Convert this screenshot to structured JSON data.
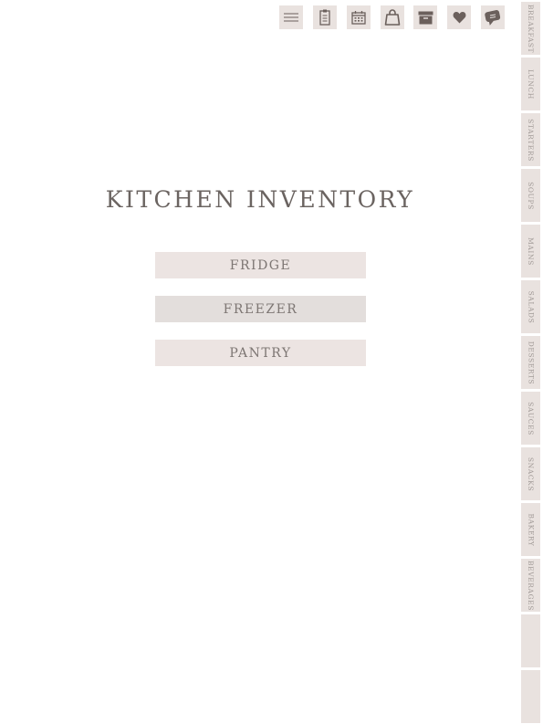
{
  "toolbar": {
    "items": [
      {
        "name": "menu",
        "icon": "menu-icon"
      },
      {
        "name": "notes",
        "icon": "notepad-icon"
      },
      {
        "name": "calendar",
        "icon": "calendar-icon"
      },
      {
        "name": "shopping",
        "icon": "shopping-bag-icon"
      },
      {
        "name": "archive",
        "icon": "archive-box-icon"
      },
      {
        "name": "favorites",
        "icon": "heart-icon"
      },
      {
        "name": "chat",
        "icon": "speech-bubble-icon"
      }
    ],
    "icon_color": "#6b605c",
    "button_color": "#e9e2df"
  },
  "title": "KITCHEN INVENTORY",
  "buttons": {
    "fridge": "FRIDGE",
    "freezer": "FREEZER",
    "pantry": "PANTRY"
  },
  "side_tabs": [
    "BREAKFAST",
    "LUNCH",
    "STARTERS",
    "SOUPS",
    "MAINS",
    "SALADS",
    "DESSERTS",
    "SAUCES",
    "SNACKS",
    "BAKERY",
    "BEVERAGES",
    "",
    ""
  ]
}
